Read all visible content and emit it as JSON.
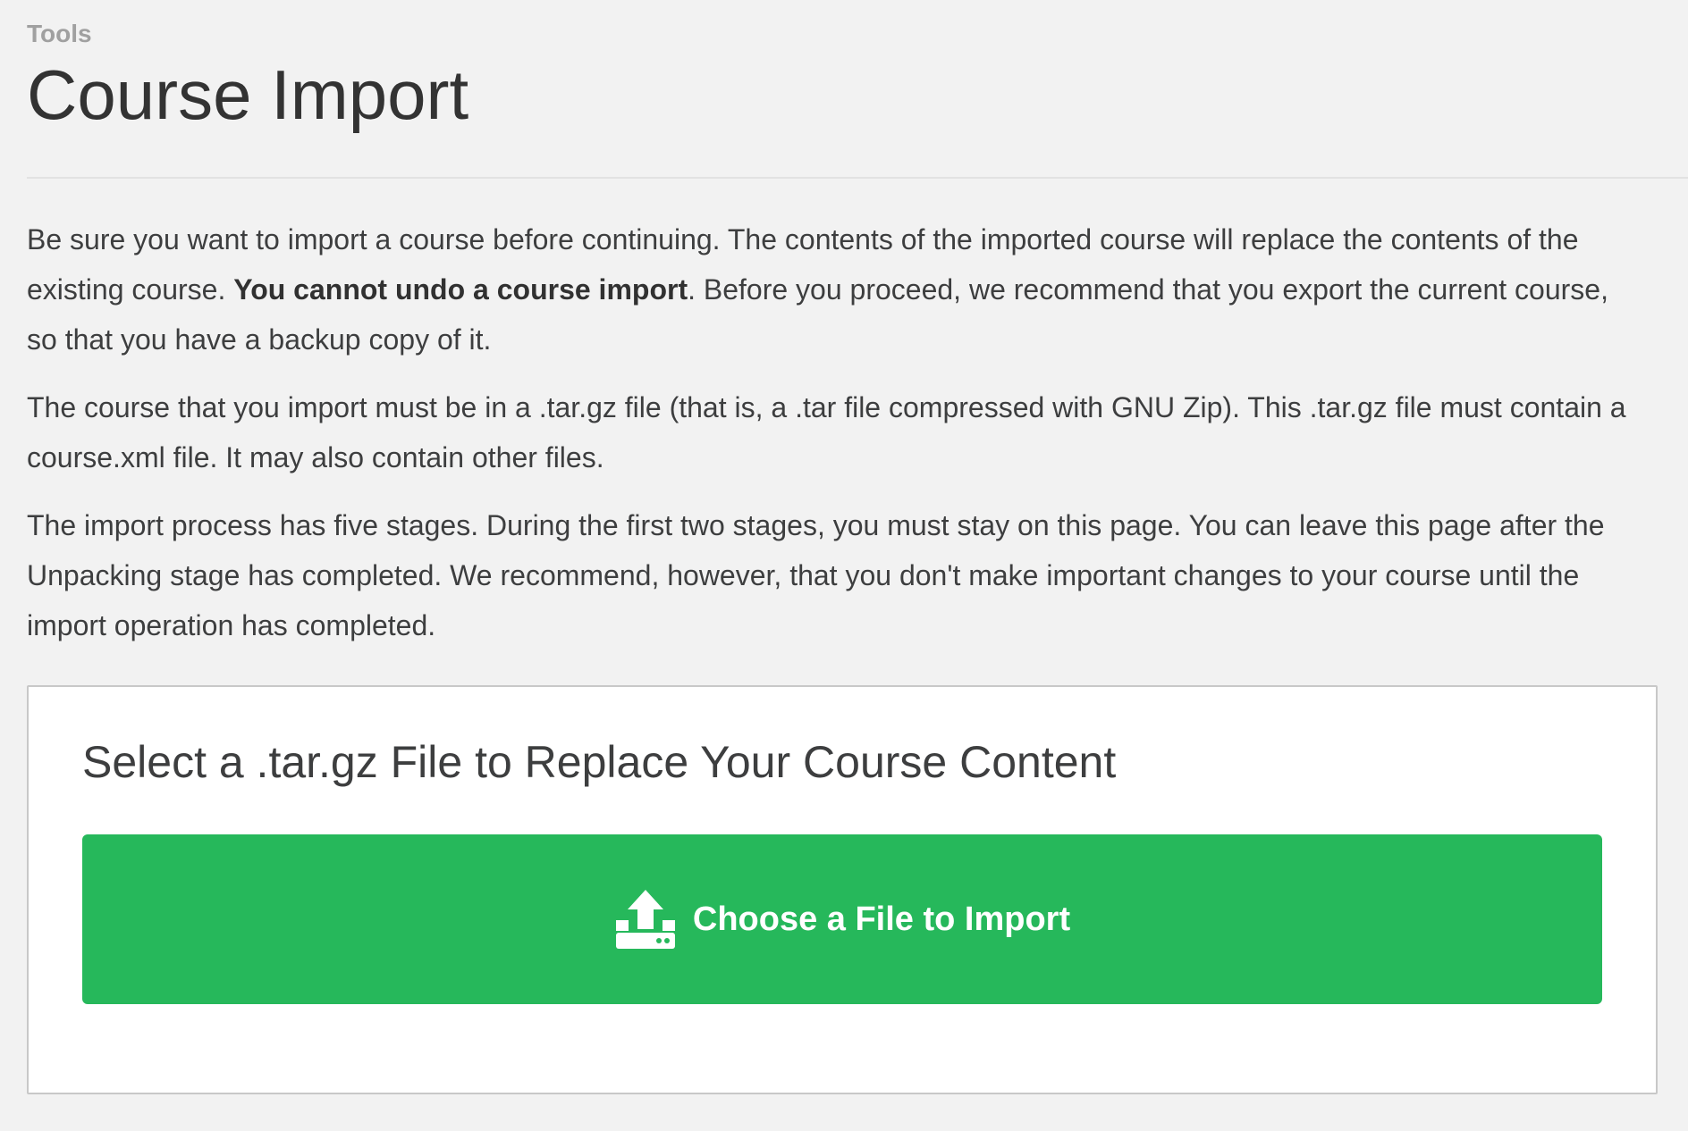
{
  "header": {
    "section": "Tools",
    "title": "Course Import"
  },
  "intro": {
    "p1_before": "Be sure you want to import a course before continuing. The contents of the imported course will replace the contents of the existing course. ",
    "p1_bold": "You cannot undo a course import",
    "p1_after": ". Before you proceed, we recommend that you export the current course, so that you have a backup copy of it.",
    "p2": "The course that you import must be in a .tar.gz file (that is, a .tar file compressed with GNU Zip). This .tar.gz file must contain a course.xml file. It may also contain other files.",
    "p3": "The import process has five stages. During the first two stages, you must stay on this page. You can leave this page after the Unpacking stage has completed. We recommend, however, that you don't make important changes to your course until the import operation has completed."
  },
  "panel": {
    "title": "Select a .tar.gz File to Replace Your Course Content",
    "button_label": "Choose a File to Import",
    "button_icon": "upload-icon"
  },
  "colors": {
    "background": "#f2f2f2",
    "button": "#26b85b",
    "text": "#3d3e3f"
  }
}
